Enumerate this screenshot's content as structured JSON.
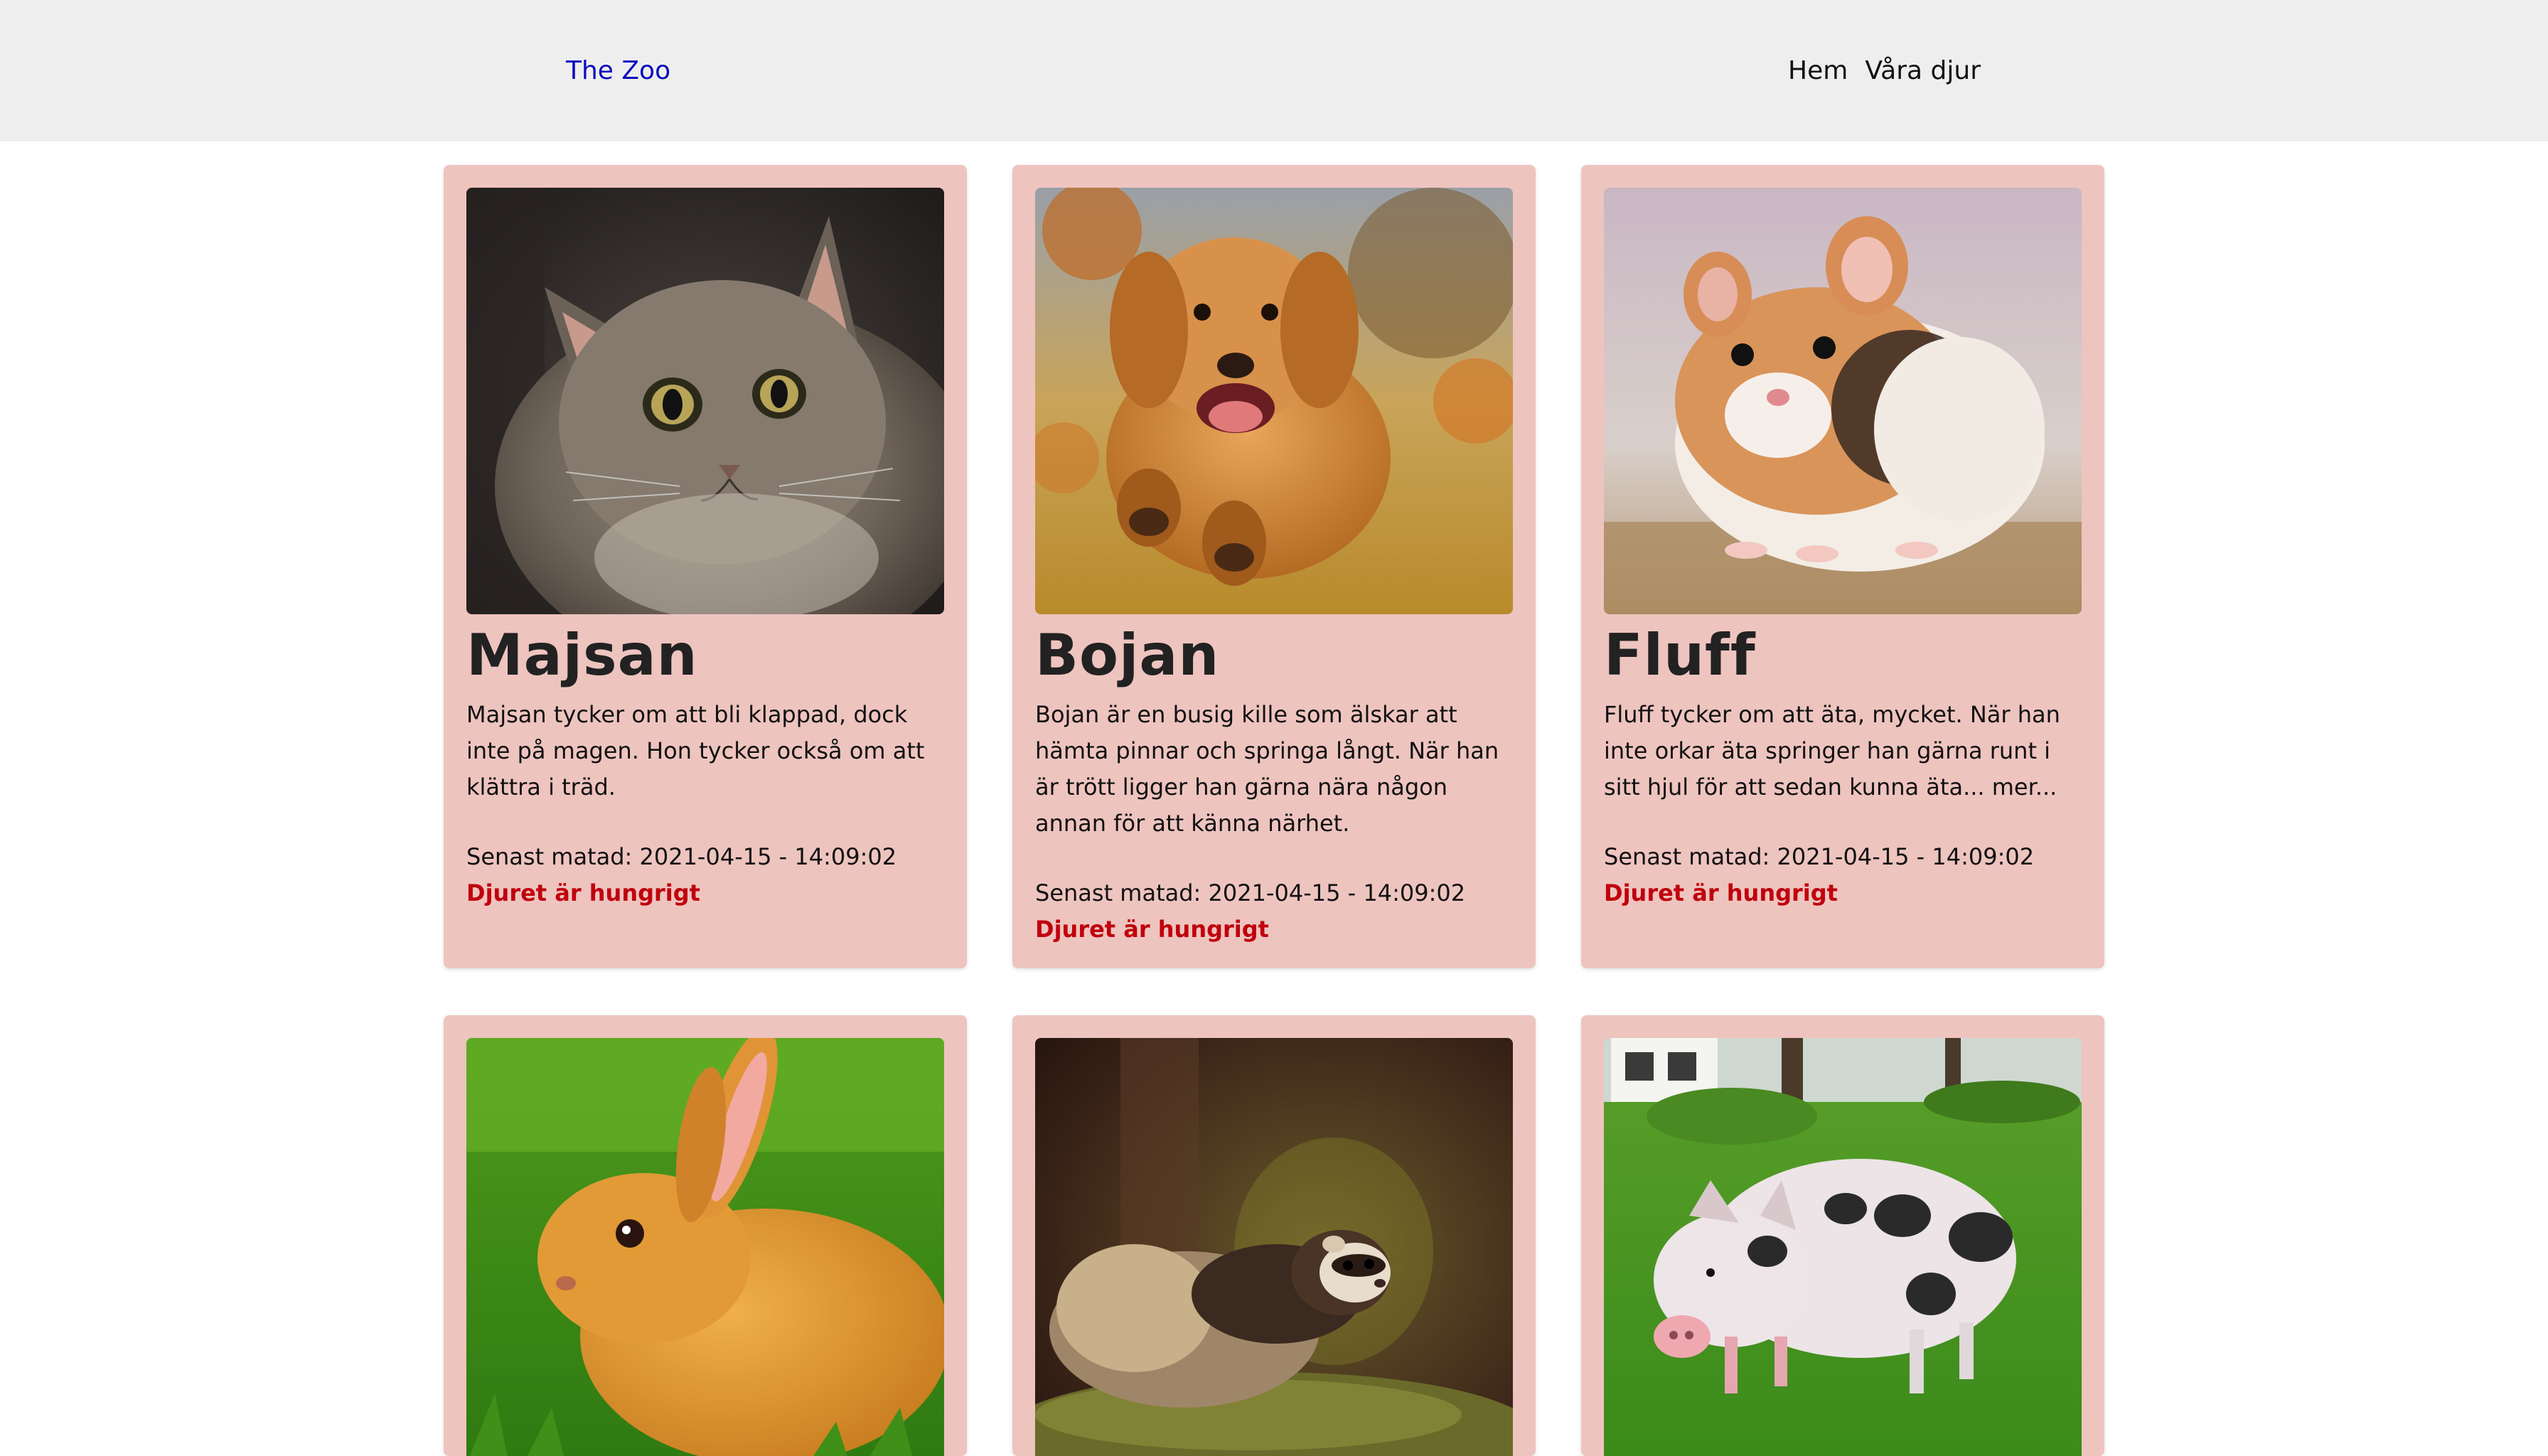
{
  "nav": {
    "brand": "The Zoo",
    "links": [
      "Hem",
      "Våra djur"
    ]
  },
  "animals": [
    {
      "name": "Majsan",
      "description": "Majsan tycker om att bli klappad, dock inte på magen. Hon tycker också om att klättra i träd.",
      "fed_text": "Senast matad: 2021-04-15 - 14:09:02",
      "status_text": "Djuret är hungrigt",
      "image": "cat"
    },
    {
      "name": "Bojan",
      "description": "Bojan är en busig kille som älskar att hämta pinnar och springa långt. När han är trött ligger han gärna nära någon annan för att känna närhet.",
      "fed_text": "Senast matad: 2021-04-15 - 14:09:02",
      "status_text": "Djuret är hungrigt",
      "image": "dog"
    },
    {
      "name": "Fluff",
      "description": "Fluff tycker om att äta, mycket. När han inte orkar äta springer han gärna runt i sitt hjul för att sedan kunna äta... mer...",
      "fed_text": "Senast matad: 2021-04-15 - 14:09:02",
      "status_text": "Djuret är hungrigt",
      "image": "hamster"
    },
    {
      "image": "rabbit"
    },
    {
      "image": "ferret"
    },
    {
      "image": "pig"
    }
  ],
  "colors": {
    "navbar_bg": "#eeeeee",
    "brand": "#0b0bbf",
    "card_bg": "#eec4bf",
    "hungry": "#c0000c"
  }
}
